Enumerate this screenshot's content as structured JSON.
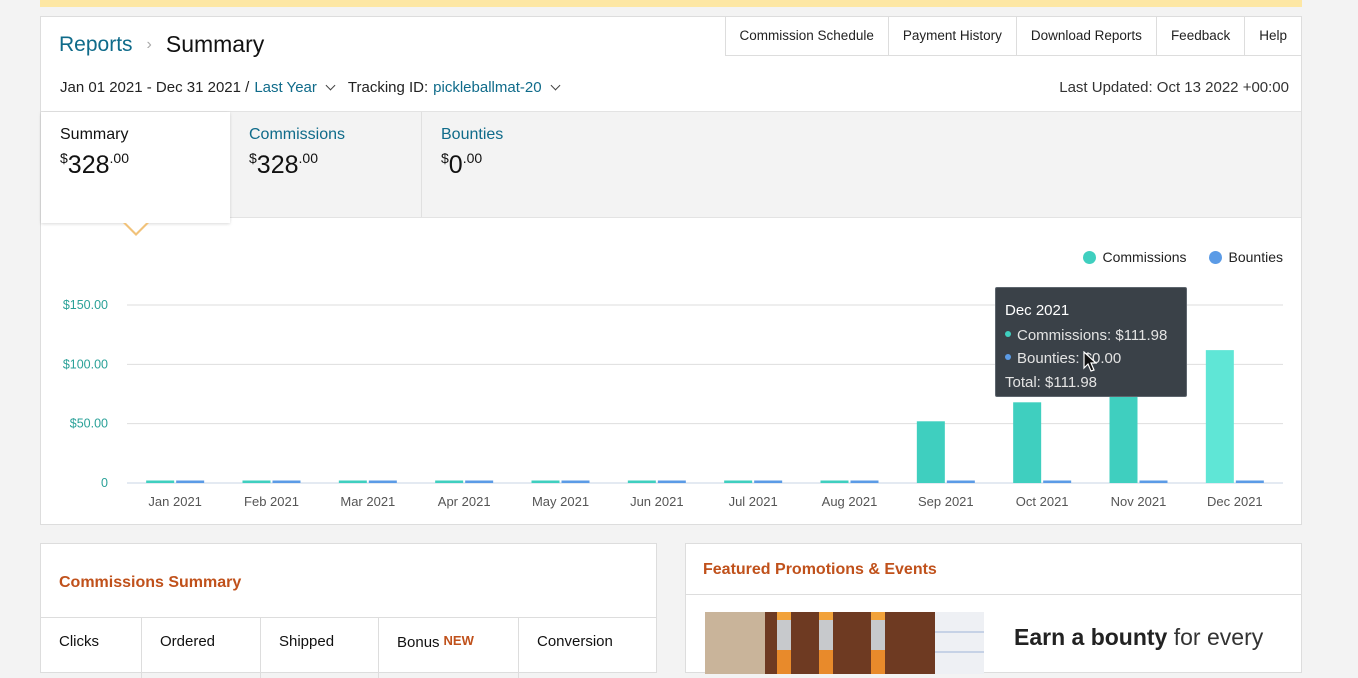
{
  "breadcrumb": {
    "root": "Reports",
    "current": "Summary"
  },
  "toolbar": {
    "items": [
      "Commission Schedule",
      "Payment History",
      "Download Reports",
      "Feedback",
      "Help"
    ]
  },
  "filters": {
    "date_range": "Jan 01 2021 - Dec 31 2021 /",
    "period": "Last Year",
    "tracking_label": "Tracking ID:",
    "tracking_id": "pickleballmat-20"
  },
  "last_updated": "Last Updated: Oct 13 2022 +00:00",
  "tabs": [
    {
      "label": "Summary",
      "currency": "$",
      "whole": "328",
      "cents": ".00"
    },
    {
      "label": "Commissions",
      "currency": "$",
      "whole": "328",
      "cents": ".00"
    },
    {
      "label": "Bounties",
      "currency": "$",
      "whole": "0",
      "cents": ".00"
    }
  ],
  "colors": {
    "commissions": "#3fcfbf",
    "bounties": "#5b9be6",
    "accent_link": "#0f6b8a",
    "section_head": "#c0511b"
  },
  "chart_data": {
    "type": "bar",
    "categories": [
      "Jan 2021",
      "Feb 2021",
      "Mar 2021",
      "Apr 2021",
      "May 2021",
      "Jun 2021",
      "Jul 2021",
      "Aug 2021",
      "Sep 2021",
      "Oct 2021",
      "Nov 2021",
      "Dec 2021"
    ],
    "series": [
      {
        "name": "Commissions",
        "values": [
          0,
          0,
          0,
          0,
          0,
          0,
          0,
          0,
          52,
          68,
          96,
          111.98
        ]
      },
      {
        "name": "Bounties",
        "values": [
          0,
          0,
          0,
          0,
          0,
          0,
          0,
          0,
          0,
          0,
          0,
          0
        ]
      }
    ],
    "yticks": [
      {
        "value": 0,
        "label": "0"
      },
      {
        "value": 50,
        "label": "$50.00"
      },
      {
        "value": 100,
        "label": "$100.00"
      },
      {
        "value": 150,
        "label": "$150.00"
      }
    ],
    "ylim": [
      0,
      150
    ],
    "grid": true,
    "legend": "top-right"
  },
  "tooltip": {
    "title": "Dec 2021",
    "commissions": "Commissions: $111.98",
    "bounties": "Bounties: $0.00",
    "total": "Total: $111.98"
  },
  "commissions_summary": {
    "title": "Commissions Summary",
    "columns": [
      "Clicks",
      "Ordered",
      "Shipped",
      "Bonus",
      "Conversion"
    ],
    "new_badge": "NEW"
  },
  "promotions": {
    "title": "Featured Promotions & Events",
    "headline_bold": "Earn a bounty",
    "headline_rest": " for every"
  }
}
